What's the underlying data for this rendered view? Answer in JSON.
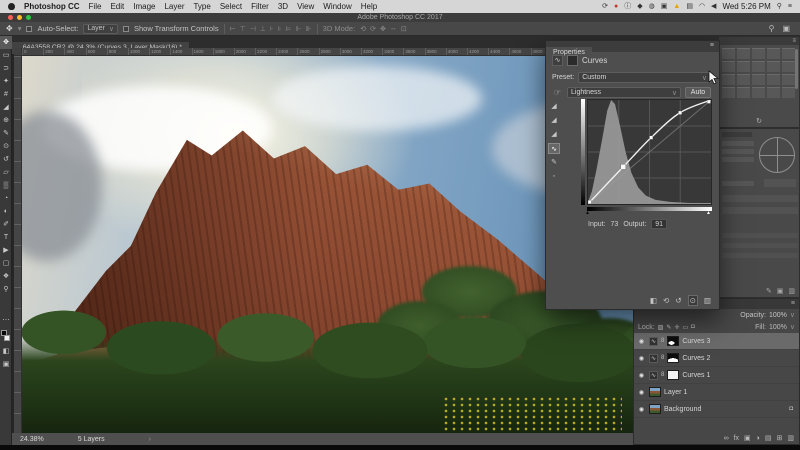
{
  "menu_bar": {
    "app_name": "Photoshop CC",
    "menus": [
      "File",
      "Edit",
      "Image",
      "Layer",
      "Type",
      "Select",
      "Filter",
      "3D",
      "View",
      "Window",
      "Help"
    ],
    "status_icons": [
      {
        "name": "sync-icon",
        "glyph": "⟳",
        "tone": ""
      },
      {
        "name": "app-badge-icon",
        "glyph": "●",
        "tone": "red"
      },
      {
        "name": "info-icon",
        "glyph": "ⓘ",
        "tone": ""
      },
      {
        "name": "shield-icon",
        "glyph": "◆",
        "tone": ""
      },
      {
        "name": "keyboard-icon",
        "glyph": "◍",
        "tone": ""
      },
      {
        "name": "display-icon",
        "glyph": "▣",
        "tone": ""
      },
      {
        "name": "warning-icon",
        "glyph": "▲",
        "tone": "yellow"
      },
      {
        "name": "battery-icon",
        "glyph": "▤",
        "tone": ""
      },
      {
        "name": "wifi-icon",
        "glyph": "◠",
        "tone": ""
      },
      {
        "name": "volume-icon",
        "glyph": "◀",
        "tone": ""
      }
    ],
    "clock": "Wed 5:26 PM",
    "spotlight_glyph": "⚲",
    "notification_center_glyph": "≡"
  },
  "title_bar": {
    "title": "Adobe Photoshop CC 2017"
  },
  "options_bar": {
    "tool_glyph": "✥",
    "auto_select_label": "Auto-Select:",
    "auto_select_value": "Layer",
    "show_transform_label": "Show Transform Controls",
    "align_icons": [
      {
        "name": "align-left-icon",
        "glyph": "⊢"
      },
      {
        "name": "align-center-h-icon",
        "glyph": "⊤"
      },
      {
        "name": "align-right-icon",
        "glyph": "⊣"
      },
      {
        "name": "align-top-icon",
        "glyph": "⊥"
      },
      {
        "name": "align-middle-icon",
        "glyph": "⊦"
      },
      {
        "name": "align-bottom-icon",
        "glyph": "⊧"
      },
      {
        "name": "distribute-h-icon",
        "glyph": "⊨"
      },
      {
        "name": "distribute-v-icon",
        "glyph": "⊩"
      },
      {
        "name": "distribute-gap-icon",
        "glyph": "⊪"
      }
    ],
    "mode_label": "3D Mode:",
    "mode_icons": [
      {
        "name": "3d-rotate-icon",
        "glyph": "⟲"
      },
      {
        "name": "3d-roll-icon",
        "glyph": "⟳"
      },
      {
        "name": "3d-drag-icon",
        "glyph": "✥"
      },
      {
        "name": "3d-slide-icon",
        "glyph": "↔"
      },
      {
        "name": "3d-scale-icon",
        "glyph": "⊡"
      }
    ],
    "search_glyph": "⚲",
    "workspace_glyph": "▣"
  },
  "document": {
    "tab_title": "_64A3558.CR2 @ 24.3% (Curves 3, Layer Mask/16) *",
    "ruler_numbers": [
      "0",
      "200",
      "400",
      "600",
      "800",
      "1000",
      "1200",
      "1400",
      "1600",
      "1800",
      "2000",
      "2200",
      "2400",
      "2600",
      "2800",
      "3000",
      "3200",
      "3400",
      "3600",
      "3800",
      "4000",
      "4200",
      "4400",
      "4600",
      "4800",
      "5000",
      "5200",
      "5400",
      "5600",
      "5800",
      "6000"
    ],
    "zoom_readout": "24.38%",
    "layer_count_readout": "5 Layers",
    "status_chevron": "›"
  },
  "toolbar": {
    "tools": [
      {
        "name": "move-tool",
        "glyph": "✥",
        "selected": true
      },
      {
        "name": "marquee-tool",
        "glyph": "▭"
      },
      {
        "name": "lasso-tool",
        "glyph": "⊃"
      },
      {
        "name": "quick-selection-tool",
        "glyph": "✦"
      },
      {
        "name": "crop-tool",
        "glyph": "#"
      },
      {
        "name": "eyedropper-tool",
        "glyph": "◢"
      },
      {
        "name": "healing-brush-tool",
        "glyph": "⊕"
      },
      {
        "name": "brush-tool",
        "glyph": "✎"
      },
      {
        "name": "clone-stamp-tool",
        "glyph": "⊙"
      },
      {
        "name": "history-brush-tool",
        "glyph": "↺"
      },
      {
        "name": "eraser-tool",
        "glyph": "▱"
      },
      {
        "name": "gradient-tool",
        "glyph": "▒"
      },
      {
        "name": "blur-tool",
        "glyph": "◔"
      },
      {
        "name": "dodge-tool",
        "glyph": "◐"
      },
      {
        "name": "pen-tool",
        "glyph": "✐"
      },
      {
        "name": "type-tool",
        "glyph": "T"
      },
      {
        "name": "path-selection-tool",
        "glyph": "▶"
      },
      {
        "name": "shape-tool",
        "glyph": "▢"
      },
      {
        "name": "hand-tool",
        "glyph": "❖"
      },
      {
        "name": "zoom-tool",
        "glyph": "⚲"
      }
    ],
    "bottom_tools": [
      {
        "name": "edit-toolbar",
        "glyph": "⋯"
      },
      {
        "name": "quick-mask-mode",
        "glyph": "◧"
      },
      {
        "name": "screen-mode",
        "glyph": "▣"
      }
    ]
  },
  "properties_panel": {
    "tab_label": "Properties",
    "panel_menu_glyph": "≡",
    "adjustment_icon_glyph": "∿",
    "adjustment_title": "Curves",
    "preset_label": "Preset:",
    "preset_value": "Custom",
    "targeted_adjustment_glyph": "☞",
    "channel_value": "Lightness",
    "auto_button_label": "Auto",
    "side_tools": [
      {
        "name": "black-point-eyedropper",
        "glyph": "◢",
        "on": false
      },
      {
        "name": "gray-point-eyedropper",
        "glyph": "◢",
        "on": false
      },
      {
        "name": "white-point-eyedropper",
        "glyph": "◢",
        "on": false
      },
      {
        "name": "edit-points-tool",
        "glyph": "∿",
        "on": true
      },
      {
        "name": "pencil-tool",
        "glyph": "✎",
        "on": false
      },
      {
        "name": "smooth-tool",
        "glyph": "◦",
        "on": false
      }
    ],
    "input_label": "Input:",
    "input_value": "73",
    "output_label": "Output:",
    "output_value": "91",
    "footer_icons": [
      {
        "name": "clip-to-layer-icon",
        "glyph": "◧",
        "boxed": false
      },
      {
        "name": "view-previous-state-icon",
        "glyph": "⟲",
        "boxed": false
      },
      {
        "name": "reset-icon",
        "glyph": "↺",
        "boxed": false
      },
      {
        "name": "visibility-eye-icon",
        "glyph": "⊙",
        "boxed": true
      },
      {
        "name": "delete-adjustment-icon",
        "glyph": "▥",
        "boxed": false
      }
    ],
    "curve": {
      "channel": "Lightness",
      "points": [
        [
          0,
          0
        ],
        [
          73,
          91
        ],
        [
          131,
          163
        ],
        [
          191,
          224
        ],
        [
          255,
          255
        ]
      ],
      "selected_point": [
        73,
        91
      ],
      "histogram": [
        [
          0,
          2
        ],
        [
          8,
          12
        ],
        [
          18,
          34
        ],
        [
          30,
          64
        ],
        [
          40,
          90
        ],
        [
          48,
          100
        ],
        [
          56,
          96
        ],
        [
          66,
          76
        ],
        [
          78,
          50
        ],
        [
          90,
          30
        ],
        [
          104,
          16
        ],
        [
          120,
          8
        ],
        [
          140,
          4
        ],
        [
          170,
          2
        ],
        [
          210,
          1
        ],
        [
          255,
          1
        ]
      ]
    }
  },
  "layers_panel": {
    "panel_menu_glyph": "≡",
    "opacity_label": "Opacity:",
    "opacity_value": "100%",
    "lock_label": "Lock:",
    "lock_icons": [
      {
        "name": "lock-transparency-icon",
        "glyph": "▨"
      },
      {
        "name": "lock-pixels-icon",
        "glyph": "✎"
      },
      {
        "name": "lock-position-icon",
        "glyph": "✛"
      },
      {
        "name": "lock-artboard-icon",
        "glyph": "▭"
      },
      {
        "name": "lock-all-icon",
        "glyph": "◘"
      }
    ],
    "fill_label": "Fill:",
    "fill_value": "100%",
    "layers": [
      {
        "name": "Curves 3",
        "kind": "adjustment",
        "mask": "black-blob",
        "selected": true,
        "locked": false
      },
      {
        "name": "Curves 2",
        "kind": "adjustment",
        "mask": "black-mountain",
        "selected": false,
        "locked": false
      },
      {
        "name": "Curves 1",
        "kind": "adjustment",
        "mask": "white",
        "selected": false,
        "locked": false
      },
      {
        "name": "Layer 1",
        "kind": "image",
        "selected": false,
        "locked": false
      },
      {
        "name": "Background",
        "kind": "image",
        "selected": false,
        "locked": true
      }
    ],
    "footer_icons": [
      {
        "name": "link-layers-icon",
        "glyph": "∞"
      },
      {
        "name": "layer-style-icon",
        "glyph": "fx"
      },
      {
        "name": "add-layer-mask-icon",
        "glyph": "▣"
      },
      {
        "name": "new-adjustment-layer-icon",
        "glyph": "◑"
      },
      {
        "name": "new-group-icon",
        "glyph": "▤"
      },
      {
        "name": "new-layer-icon",
        "glyph": "⊞"
      },
      {
        "name": "delete-layer-icon",
        "glyph": "▥"
      }
    ]
  },
  "docks": {
    "grid_panel_footer_glyph": "↻",
    "grid_cell_count": 20,
    "brush_panel_footer_icons": [
      {
        "name": "brush-stroke-icon",
        "glyph": "✎"
      },
      {
        "name": "brush-preview-icon",
        "glyph": "▣"
      },
      {
        "name": "brush-delete-icon",
        "glyph": "▥"
      }
    ]
  }
}
